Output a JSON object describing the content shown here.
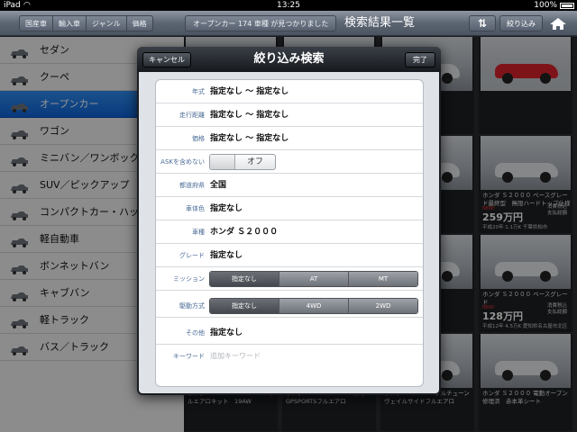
{
  "status": {
    "device": "iPad",
    "time": "13:25",
    "battery": "100%"
  },
  "nav": {
    "segments": [
      "国産車",
      "輸入車",
      "ジャンル",
      "価格"
    ],
    "count_text": "オープンカー 174 車種 が見つかりました",
    "title": "検索結果一覧",
    "filter_label": "絞り込み"
  },
  "sidebar": {
    "items": [
      {
        "label": "セダン"
      },
      {
        "label": "クーペ"
      },
      {
        "label": "オープンカー",
        "active": true
      },
      {
        "label": "ワゴン"
      },
      {
        "label": "ミニバン／ワンボック"
      },
      {
        "label": "SUV／ピックアップ"
      },
      {
        "label": "コンパクトカー・ハッ"
      },
      {
        "label": "軽自動車"
      },
      {
        "label": "ボンネットバン"
      },
      {
        "label": "キャブバン"
      },
      {
        "label": "軽トラック"
      },
      {
        "label": "バス／トラック"
      }
    ]
  },
  "results": {
    "tiles": [
      {
        "title": "",
        "price": "",
        "desc": "",
        "red": false
      },
      {
        "title": "",
        "price": "",
        "desc": "",
        "red": false
      },
      {
        "title": "",
        "price": "",
        "desc": "",
        "red": true
      },
      {
        "title": "",
        "price": "",
        "desc": "",
        "red": false
      },
      {
        "title": "",
        "price": "",
        "desc": "",
        "red": false
      },
      {
        "title": "ホンダ Ｓ２０００ ベースグレード最終型　無限ハードトップ仕様",
        "new": "NEW!",
        "price": "259万円",
        "tax": "消費税込\n支払総額",
        "desc": "平成20年 1.1万K 千葉県柏市",
        "red": false
      },
      {
        "title": "",
        "price": "",
        "desc": "",
        "red": false
      },
      {
        "title": "",
        "price": "",
        "desc": "",
        "red": false
      },
      {
        "title": "ホンダ Ｓ２０００ ベースグレード",
        "new": "NEW!",
        "price": "128万円",
        "tax": "消費税込\n支払総額",
        "desc": "平成12年 4.5万K 愛知県名古屋市北区",
        "red": false
      },
      {
        "title": "ホンダ Ｓ２０００ amuseGT1フルエアロキット　19AW",
        "price": "",
        "desc": "",
        "red": false
      },
      {
        "title": "ホンダ Ｓ２０００ EGOH鼻のGPSPORTSフルエアロ",
        "price": "",
        "desc": "",
        "red": false
      },
      {
        "title": "ホンダ Ｓ２０００ フルチューンヴェイルサイドフルエアロ",
        "price": "",
        "desc": "",
        "red": false
      },
      {
        "title": "ホンダ Ｓ２０００ 電動オープン修理済　赤本革シート",
        "price": "",
        "desc": "",
        "red": false
      }
    ]
  },
  "modal": {
    "title": "絞り込み検索",
    "cancel_label": "キャンセル",
    "done_label": "完了",
    "fields": {
      "year": {
        "label": "年式",
        "value": "指定なし 〜 指定なし"
      },
      "mileage": {
        "label": "走行距離",
        "value": "指定なし 〜 指定なし"
      },
      "price": {
        "label": "価格",
        "value": "指定なし 〜 指定なし"
      },
      "ask": {
        "label": "ASKを含めない",
        "value": "オフ"
      },
      "prefecture": {
        "label": "都道府県",
        "value": "全国"
      },
      "color": {
        "label": "車体色",
        "value": "指定なし"
      },
      "model": {
        "label": "車種",
        "value": "ホンダ Ｓ２０００"
      },
      "grade": {
        "label": "グレード",
        "value": "指定なし"
      },
      "mission": {
        "label": "ミッション",
        "options": [
          "指定なし",
          "AT",
          "MT"
        ],
        "selected": "指定なし"
      },
      "drive": {
        "label": "駆動方式",
        "options": [
          "指定なし",
          "4WD",
          "2WD"
        ],
        "selected": "指定なし"
      },
      "other": {
        "label": "その他",
        "value": "指定なし"
      },
      "keyword": {
        "label": "キーワード",
        "placeholder": "追加キーワード"
      }
    }
  }
}
